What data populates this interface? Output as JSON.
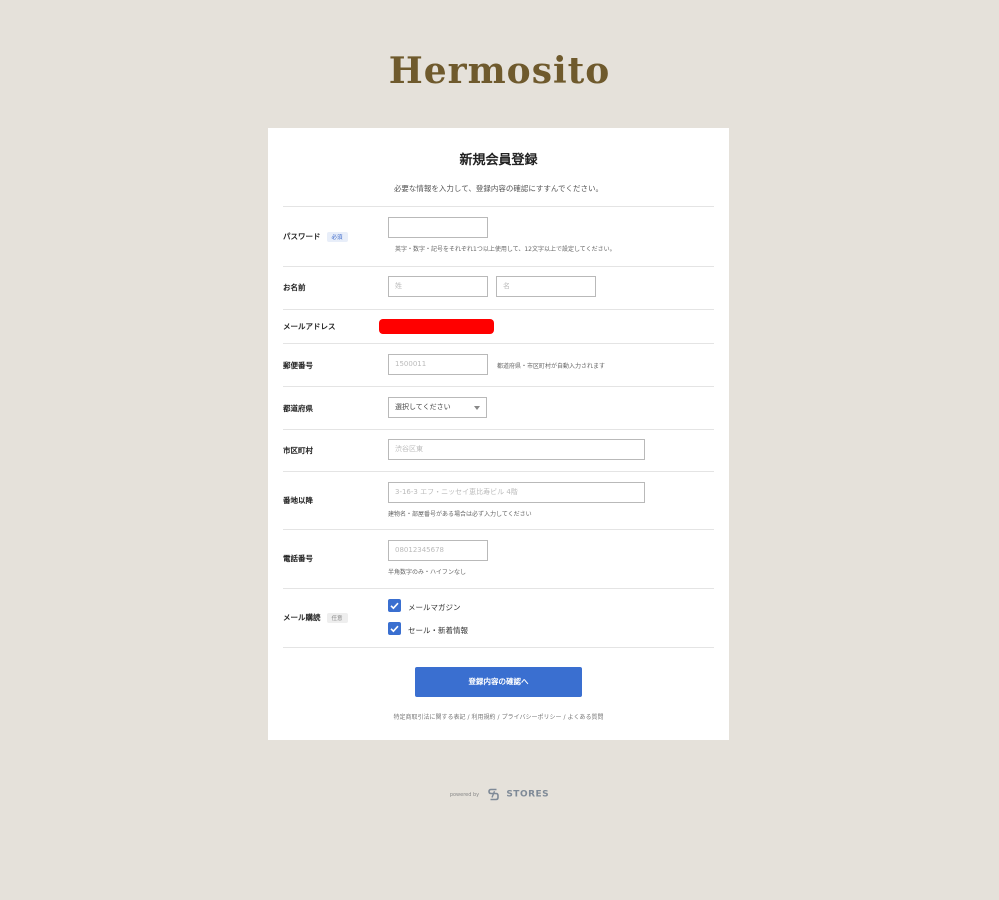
{
  "brand": {
    "logo_text": "Hermosito"
  },
  "form": {
    "title": "新規会員登録",
    "description": "必要な情報を入力して、登録内容の確認にすすんでください。",
    "badges": {
      "required": "必須",
      "optional": "任意"
    },
    "password": {
      "label": "パスワード",
      "value": "",
      "help": "英字・数字・記号をそれぞれ1つ以上使用して、12文字以上で設定してください。"
    },
    "name": {
      "label": "お名前",
      "last_placeholder": "姓",
      "first_placeholder": "名"
    },
    "email": {
      "label": "メールアドレス"
    },
    "postal": {
      "label": "郵便番号",
      "placeholder": "1500011",
      "help": "都道府県・市区町村が自動入力されます"
    },
    "prefecture": {
      "label": "都道府県",
      "selected": "選択してください"
    },
    "city": {
      "label": "市区町村",
      "placeholder": "渋谷区東"
    },
    "address": {
      "label": "番地以降",
      "placeholder": "3-16-3 エフ・ニッセイ恵比寿ビル 4階",
      "help": "建物名・部屋番号がある場合は必ず入力してください"
    },
    "phone": {
      "label": "電話番号",
      "placeholder": "08012345678",
      "help": "半角数字のみ・ハイフンなし"
    },
    "newsletter": {
      "label": "メール購読",
      "options": [
        {
          "label": "メールマガジン",
          "checked": true
        },
        {
          "label": "セール・新着情報",
          "checked": true
        }
      ]
    },
    "submit_label": "登録内容の確認へ",
    "footer_links": [
      "特定商取引法に関する表記",
      "利用規約",
      "プライバシーポリシー",
      "よくある質問"
    ]
  },
  "powered": {
    "prefix": "powered by",
    "brand": "STORES"
  },
  "colors": {
    "accent": "#3a6fd0",
    "logo": "#6f5a2d",
    "background": "#e5e1da"
  }
}
